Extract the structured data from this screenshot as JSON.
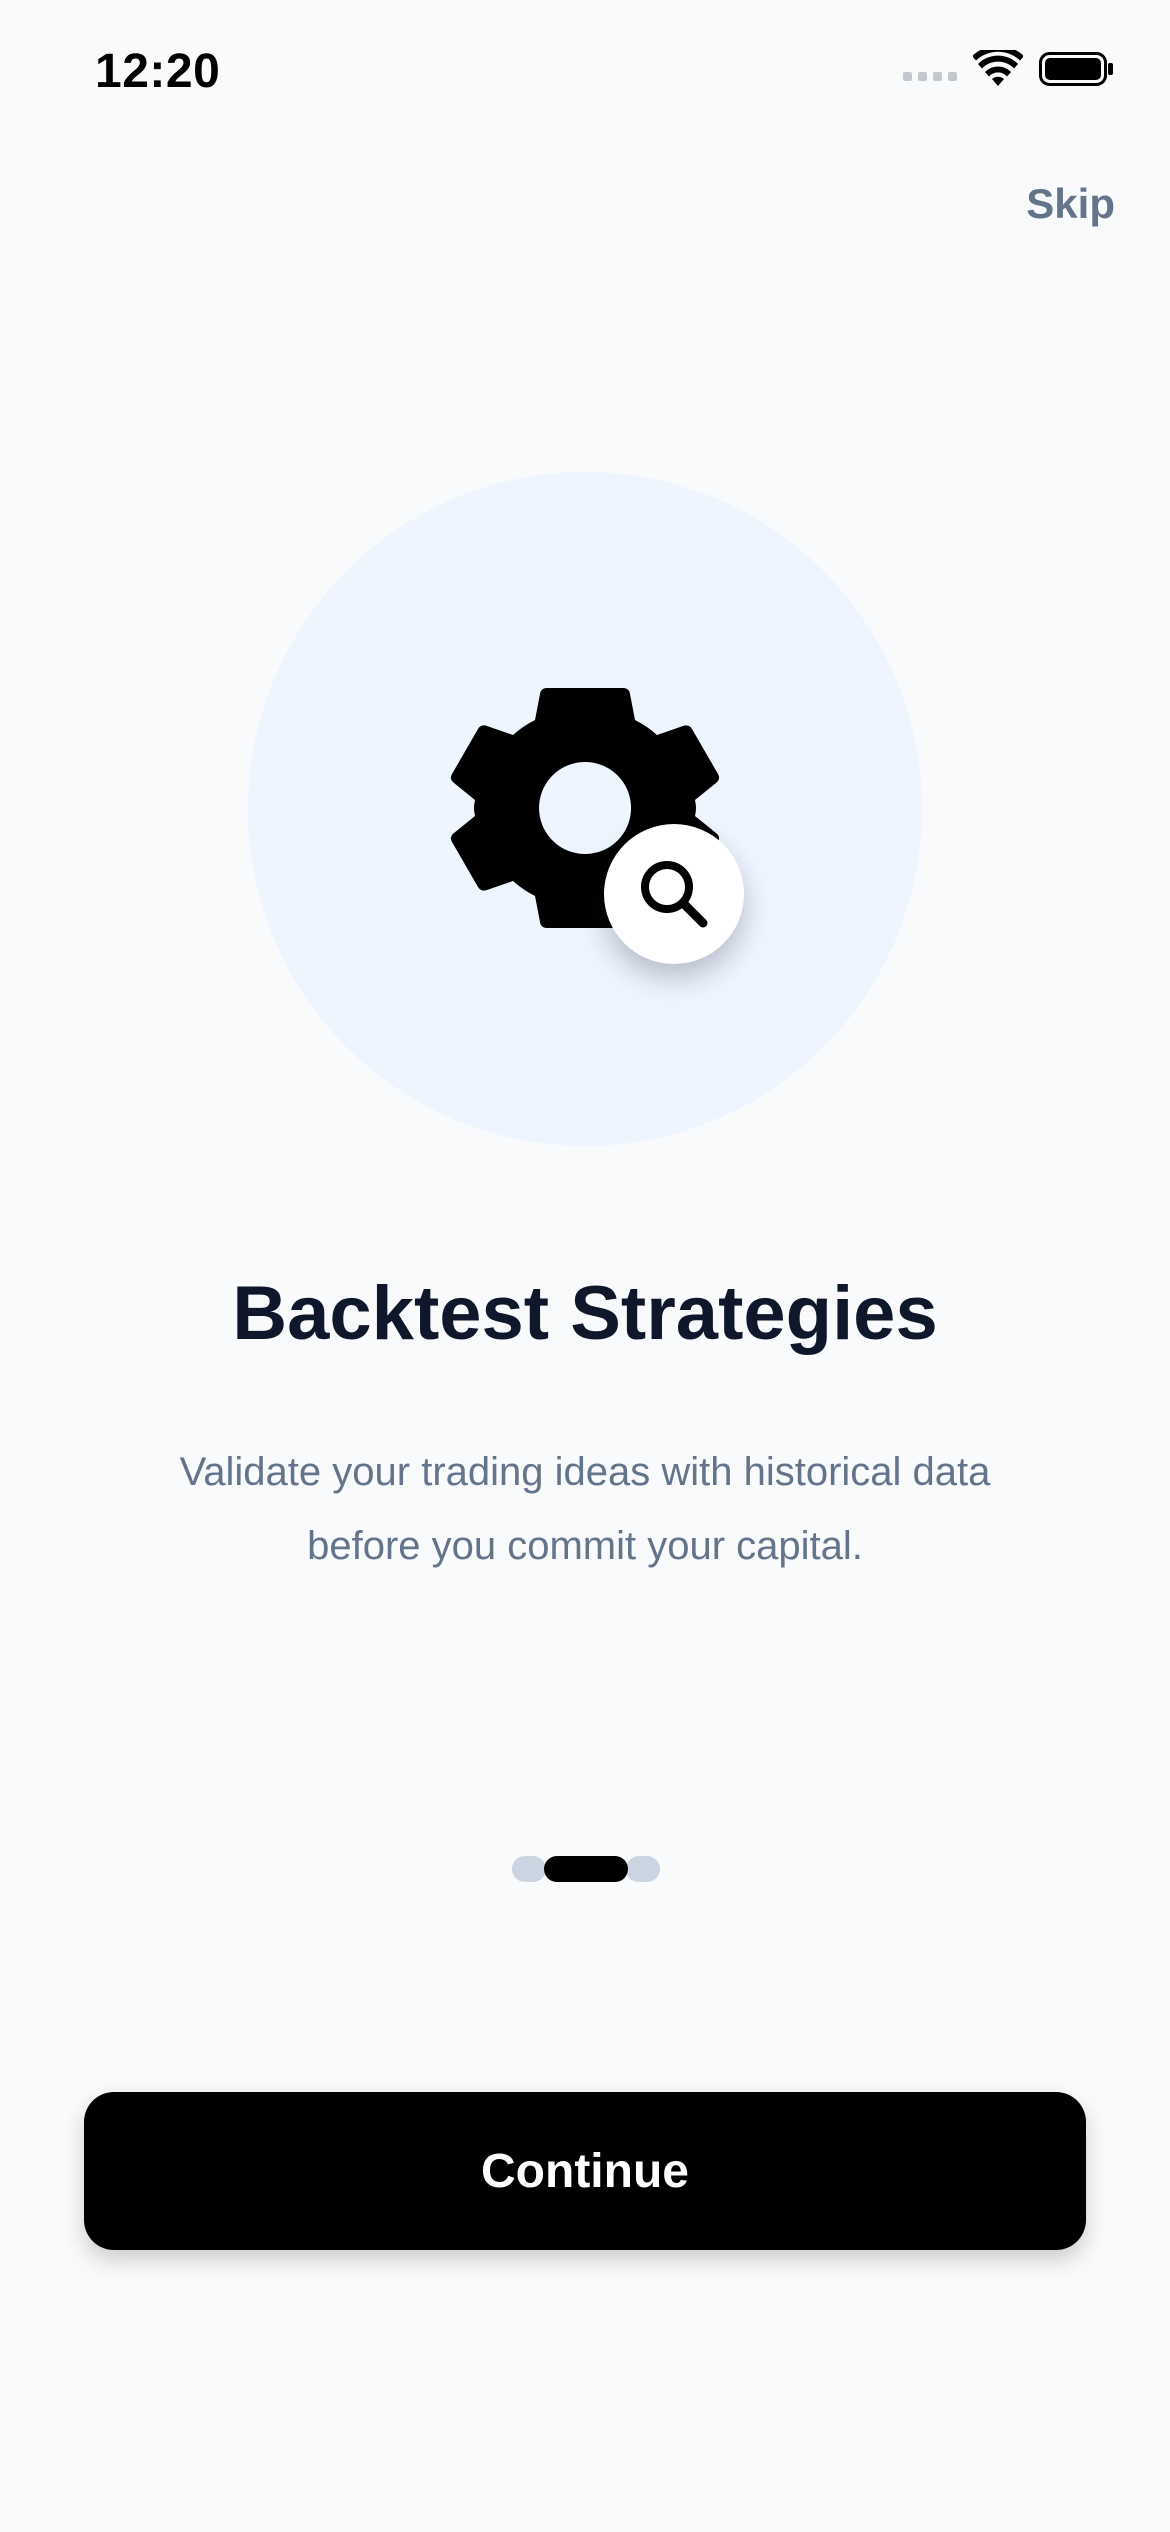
{
  "status_bar": {
    "time": "12:20",
    "icons": [
      "signal-dots-icon",
      "wifi-icon",
      "battery-icon"
    ]
  },
  "header": {
    "skip_label": "Skip"
  },
  "hero": {
    "icons": [
      "gear-icon",
      "magnifier-icon"
    ],
    "circle_color": "#EFF5FF"
  },
  "content": {
    "title": "Backtest Strategies",
    "subtitle_line1": "Validate your trading ideas with historical data",
    "subtitle_line2": "before you commit your capital."
  },
  "pager": {
    "total_pages": 3,
    "current_page": 2
  },
  "footer": {
    "continue_label": "Continue"
  },
  "colors": {
    "background": "#F8FAFC",
    "title": "#0F172A",
    "muted_text": "#64748B",
    "primary_button": "#000000",
    "pager_inactive": "#CBD5E1"
  }
}
